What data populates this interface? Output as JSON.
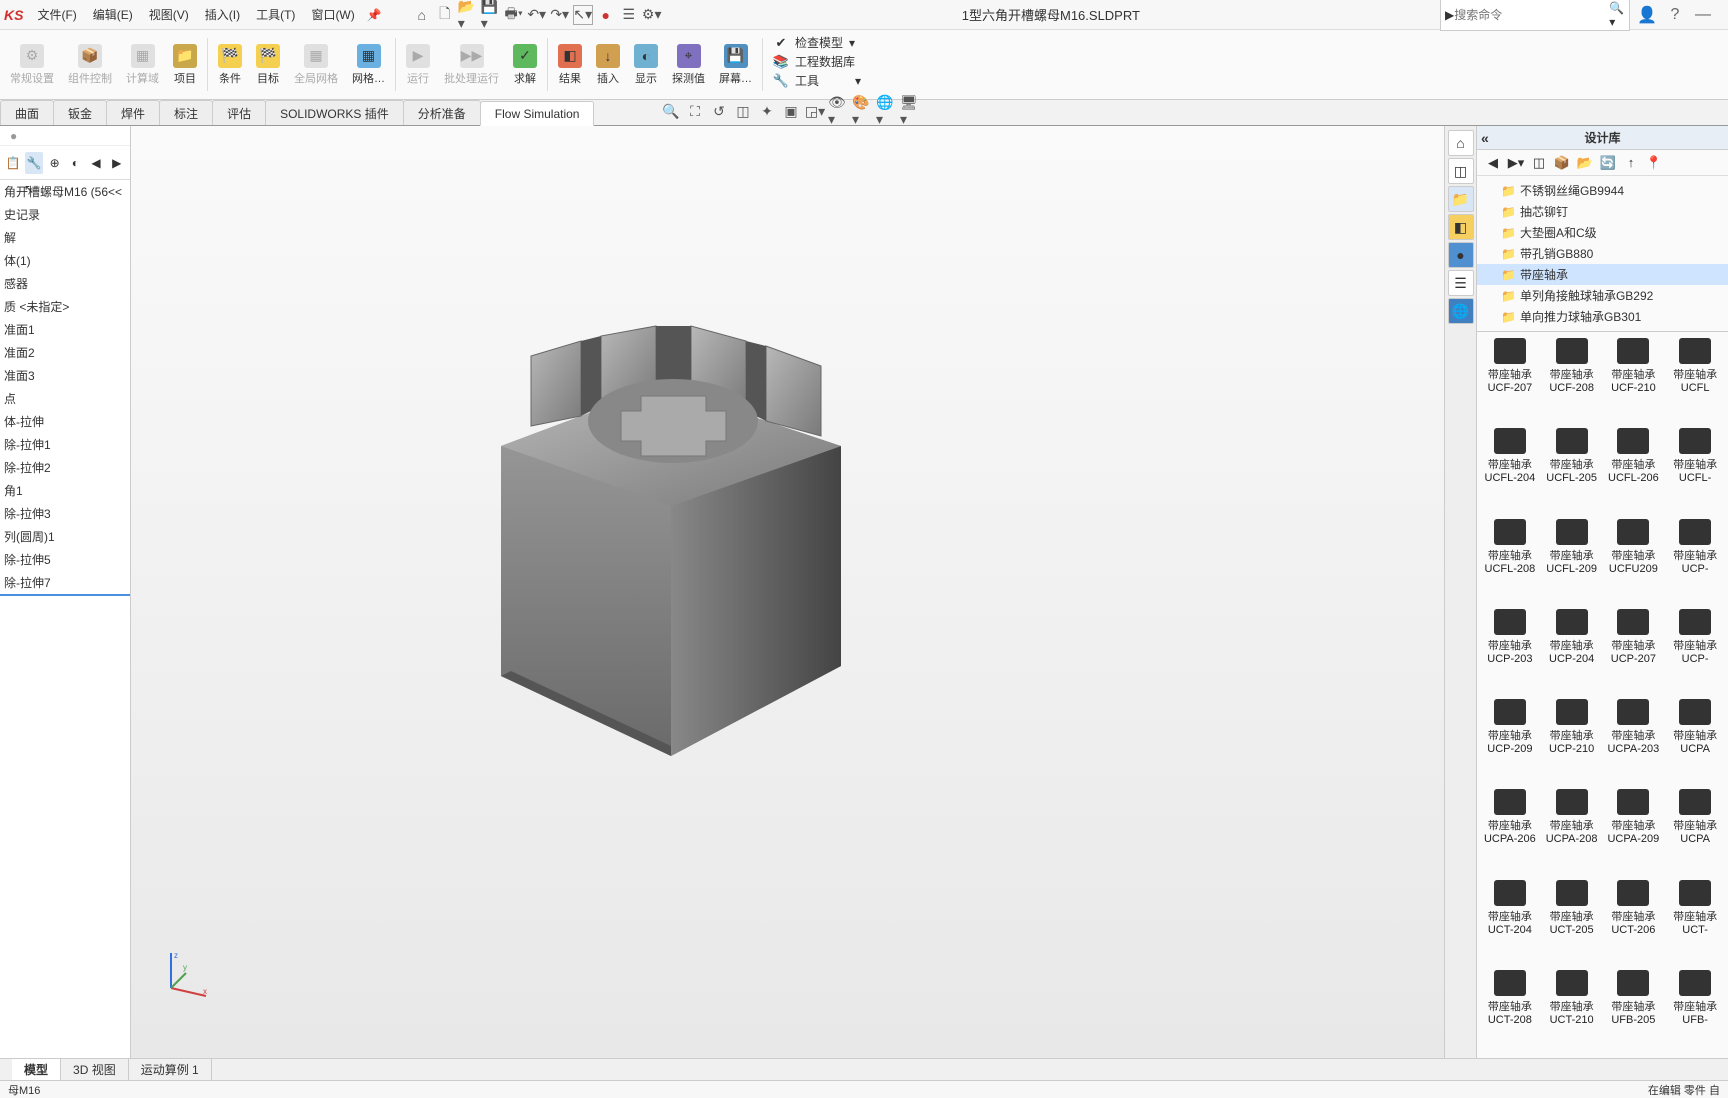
{
  "app_logo": "KS",
  "menu": [
    "文件(F)",
    "编辑(E)",
    "视图(V)",
    "插入(I)",
    "工具(T)",
    "窗口(W)"
  ],
  "document_name": "1型六角开槽螺母M16.SLDPRT",
  "search_placeholder": "搜索命令",
  "ribbon": {
    "groups_left": [
      {
        "label": "常规设置",
        "disabled": true
      },
      {
        "label": "组件控制",
        "disabled": true
      },
      {
        "label": "计算域",
        "disabled": true
      },
      {
        "label": "项目",
        "disabled": false
      }
    ],
    "groups_mid": [
      "条件",
      "目标",
      "全局网格",
      "网格…",
      "运行",
      "批处理运行",
      "求解",
      "结果",
      "插入",
      "显示",
      "探测值",
      "屏幕…"
    ],
    "disabled_mid": [
      "全局网格",
      "运行",
      "批处理运行"
    ],
    "side_rows": [
      "检查模型",
      "工程数据库",
      "工具"
    ]
  },
  "tabs": [
    "曲面",
    "钣金",
    "焊件",
    "标注",
    "评估",
    "SOLIDWORKS 插件",
    "分析准备",
    "Flow Simulation"
  ],
  "active_tab": "Flow Simulation",
  "hud_icons": [
    "search",
    "fit",
    "rotate",
    "section",
    "prev",
    "clip",
    "cube",
    "view",
    "layers",
    "appearance",
    "color",
    "screen"
  ],
  "feature_tree": {
    "root": "角开槽螺母M16 (56<<",
    "nodes": [
      "史记录",
      "解",
      "体(1)",
      "感器",
      "质 <未指定>",
      "准面1",
      "准面2",
      "准面3",
      "点",
      "体-拉伸",
      "除-拉伸1",
      "除-拉伸2",
      "角1",
      "除-拉伸3",
      "列(圆周)1",
      "除-拉伸5",
      "除-拉伸7"
    ],
    "selected": "除-拉伸7"
  },
  "side_icons": [
    "home",
    "cube",
    "folder",
    "swatch",
    "globe",
    "list",
    "world"
  ],
  "design_lib": {
    "title": "设计库",
    "toolbar": [
      "back",
      "fwd",
      "3d",
      "box",
      "open",
      "refresh",
      "up",
      "pin"
    ],
    "folders": [
      "不锈钢丝绳GB9944",
      "抽芯铆钉",
      "大垫圈A和C级",
      "带孔销GB880",
      "带座轴承",
      "单列角接触球轴承GB292",
      "单向推力球轴承GB301"
    ],
    "selected_folder": "带座轴承",
    "parts_lbl": "带座轴承",
    "parts": [
      "UCF-207",
      "UCF-208",
      "UCF-210",
      "UCFL",
      "UCFL-204",
      "UCFL-205",
      "UCFL-206",
      "UCFL-",
      "UCFL-208",
      "UCFL-209",
      "UCFU209",
      "UCP-",
      "UCP-203",
      "UCP-204",
      "UCP-207",
      "UCP-",
      "UCP-209",
      "UCP-210",
      "UCPA-203",
      "UCPA",
      "UCPA-206",
      "UCPA-208",
      "UCPA-209",
      "UCPA",
      "UCT-204",
      "UCT-205",
      "UCT-206",
      "UCT-",
      "UCT-208",
      "UCT-210",
      "UFB-205",
      "UFB-"
    ]
  },
  "bottom_tabs": [
    "模型",
    "3D 视图",
    "运动算例 1"
  ],
  "active_bottom_tab": "模型",
  "status_left": "母M16",
  "status_right": "在编辑 零件            自"
}
